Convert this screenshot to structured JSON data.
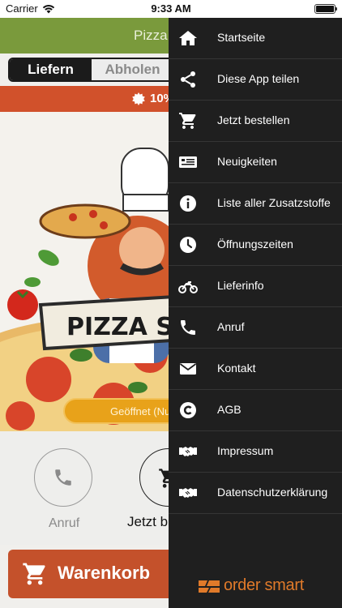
{
  "status_bar": {
    "carrier": "Carrier",
    "time": "9:33 AM"
  },
  "header": {
    "title": "Pizza"
  },
  "order_mode": {
    "deliver_label": "Liefern",
    "pickup_label": "Abholen",
    "selected": "Liefern"
  },
  "promo": {
    "text": "10%"
  },
  "hero": {
    "sign_text": "PIZZA S",
    "status_label": "Geöffnet (Nu"
  },
  "actions": {
    "call_label": "Anruf",
    "order_label": "Jetzt b"
  },
  "cart": {
    "label": "Warenkorb"
  },
  "drawer": {
    "items": [
      {
        "label": "Startseite",
        "icon": "home-icon"
      },
      {
        "label": "Diese App teilen",
        "icon": "share-icon"
      },
      {
        "label": "Jetzt bestellen",
        "icon": "cart-icon"
      },
      {
        "label": "Neuigkeiten",
        "icon": "news-icon"
      },
      {
        "label": "Liste aller Zusatzstoffe",
        "icon": "info-icon"
      },
      {
        "label": "Öffnungszeiten",
        "icon": "clock-icon"
      },
      {
        "label": "Lieferinfo",
        "icon": "motorbike-icon"
      },
      {
        "label": "Anruf",
        "icon": "phone-icon"
      },
      {
        "label": "Kontakt",
        "icon": "mail-icon"
      },
      {
        "label": "AGB",
        "icon": "copyright-icon"
      },
      {
        "label": "Impressum",
        "icon": "handshake-icon"
      },
      {
        "label": "Datenschutzerklärung",
        "icon": "handshake-icon"
      }
    ],
    "brand": "order smart"
  },
  "colors": {
    "header_green": "#7a9a3c",
    "promo_red": "#d1512b",
    "drawer_bg": "#1f1f1f",
    "cart_red": "#c4512b",
    "brand_orange": "#e07a2a",
    "open_amber": "#e8a21a"
  }
}
